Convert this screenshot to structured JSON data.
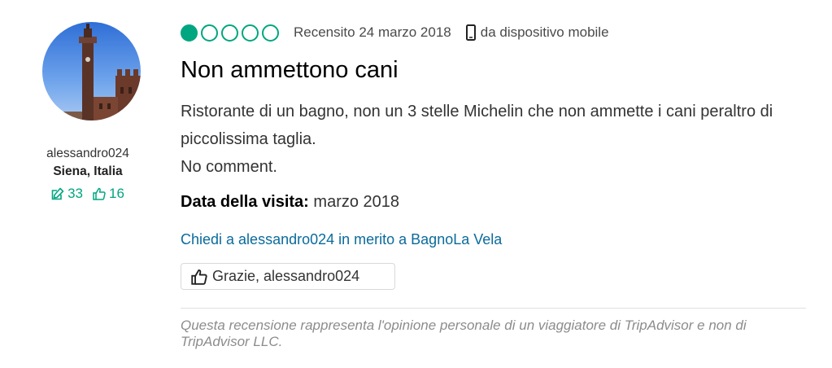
{
  "user": {
    "name": "alessandro024",
    "location": "Siena, Italia",
    "reviews_count": "33",
    "helpful_votes": "16"
  },
  "review": {
    "rating": 1,
    "rating_max": 5,
    "review_date": "Recensito 24 marzo 2018",
    "device": "da dispositivo mobile",
    "title": "Non ammettono cani",
    "body_lines": [
      "Ristorante di un bagno, non un 3 stelle Michelin che non ammette i cani peraltro di piccolissima taglia.",
      "No comment."
    ],
    "visit_label": "Data della visita:",
    "visit_value": "marzo 2018"
  },
  "actions": {
    "ask_link": "Chiedi a alessandro024 in merito a BagnoLa Vela",
    "thanks_label": "Grazie, alessandro024"
  },
  "disclaimer": "Questa recensione rappresenta l'opinione personale di un viaggiatore di TripAdvisor e non di TripAdvisor LLC.",
  "colors": {
    "accent": "#00a680",
    "link": "#0a6b9c"
  },
  "icons": {
    "review_count": "pencil-edit-icon",
    "helpful": "thumbs-up-icon",
    "device": "mobile-phone-icon",
    "thanks": "thumbs-up-icon"
  }
}
